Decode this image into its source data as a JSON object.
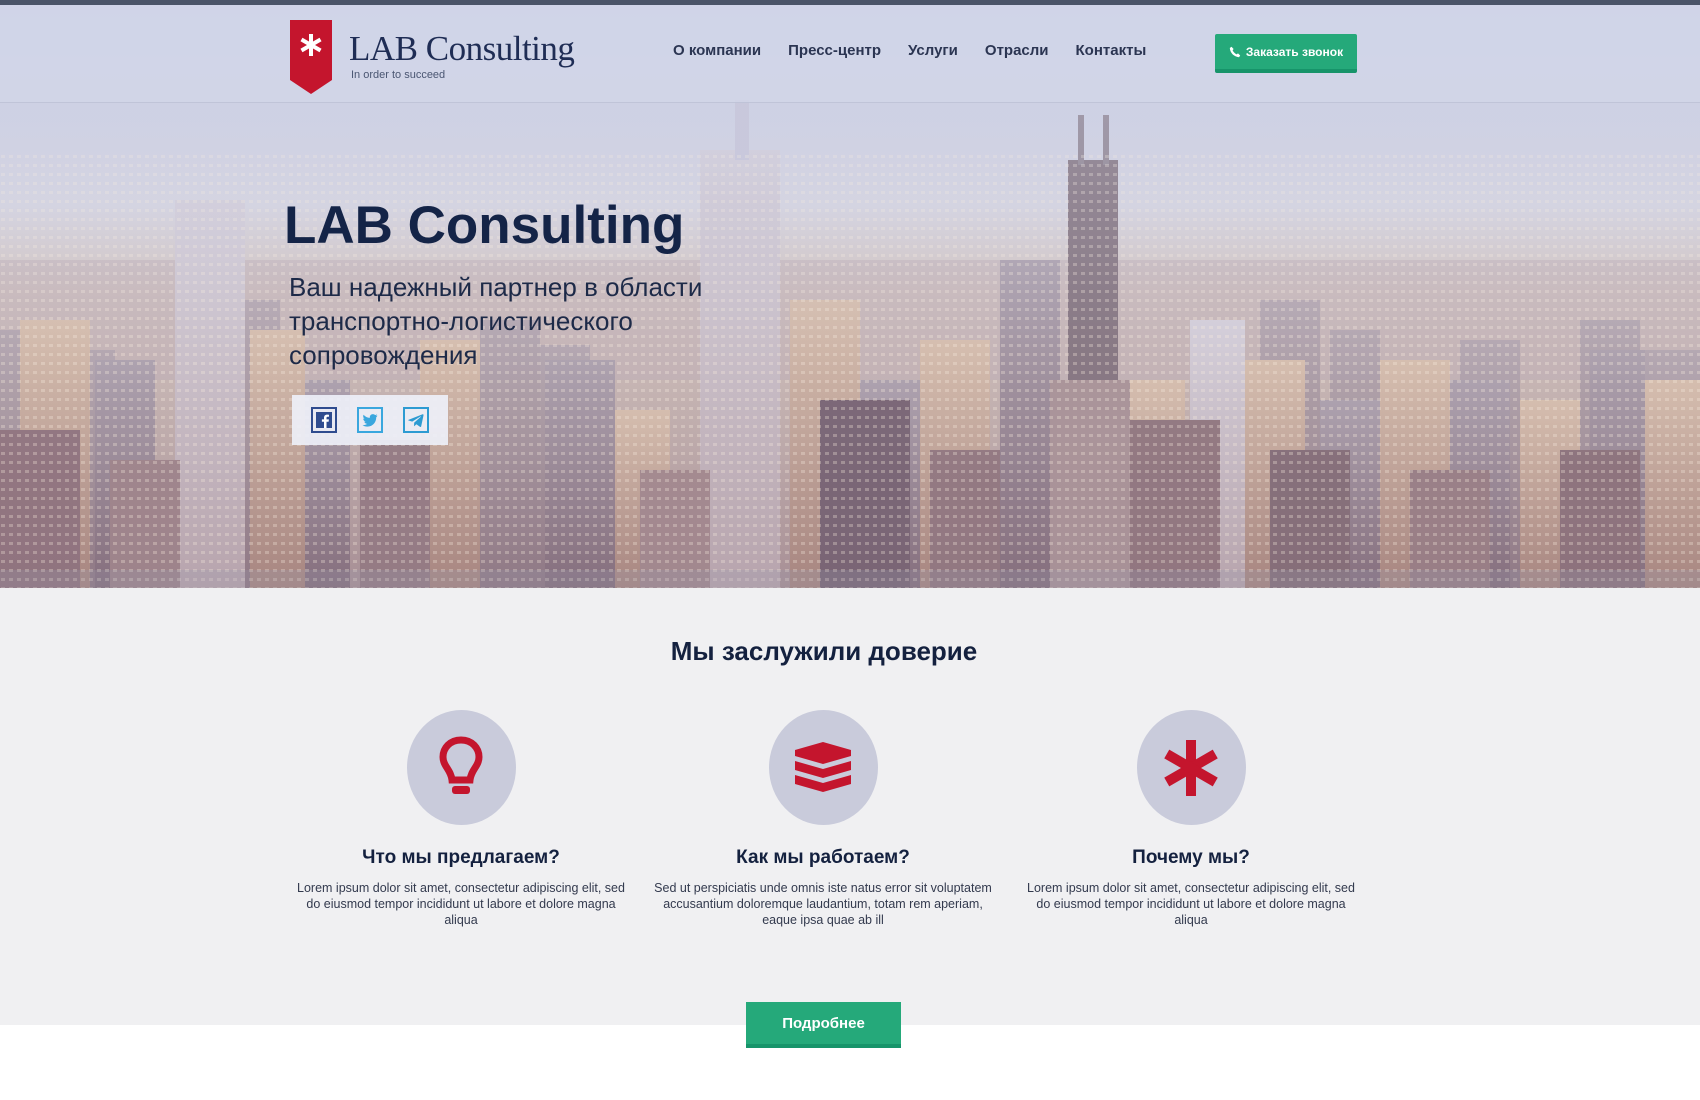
{
  "header": {
    "logo_name": "LAB Consulting",
    "logo_tagline": "In order to succeed",
    "nav": [
      {
        "label": "О компании"
      },
      {
        "label": "Пресс-центр"
      },
      {
        "label": "Услуги"
      },
      {
        "label": "Отрасли"
      },
      {
        "label": "Контакты"
      }
    ],
    "call_button": "Заказать звонок"
  },
  "hero": {
    "title": "LAB Consulting",
    "subtitle": "Ваш надежный партнер в области транспортно-логистического сопровождения",
    "social": [
      "facebook-icon",
      "twitter-icon",
      "telegram-icon"
    ]
  },
  "trust": {
    "title": "Мы заслужили доверие",
    "features": [
      {
        "icon": "lightbulb-icon",
        "heading": "Что мы предлагаем?",
        "text": "Lorem ipsum dolor sit amet, consectetur adipiscing elit, sed do eiusmod tempor incididunt ut labore et dolore magna aliqua"
      },
      {
        "icon": "layers-icon",
        "heading": "Как мы работаем?",
        "text": "Sed ut perspiciatis unde omnis iste natus error sit voluptatem accusantium doloremque laudantium, totam rem aperiam, eaque ipsa quae ab ill"
      },
      {
        "icon": "asterisk-icon",
        "heading": "Почему мы?",
        "text": "Lorem ipsum dolor sit amet, consectetur adipiscing elit, sed do eiusmod tempor incididunt ut labore et dolore magna aliqua"
      }
    ],
    "more_button": "Подробнее"
  },
  "colors": {
    "accent_green": "#25a97a",
    "brand_red": "#c4152d",
    "navy": "#142447",
    "icon_circle": "#c9cbdb"
  }
}
